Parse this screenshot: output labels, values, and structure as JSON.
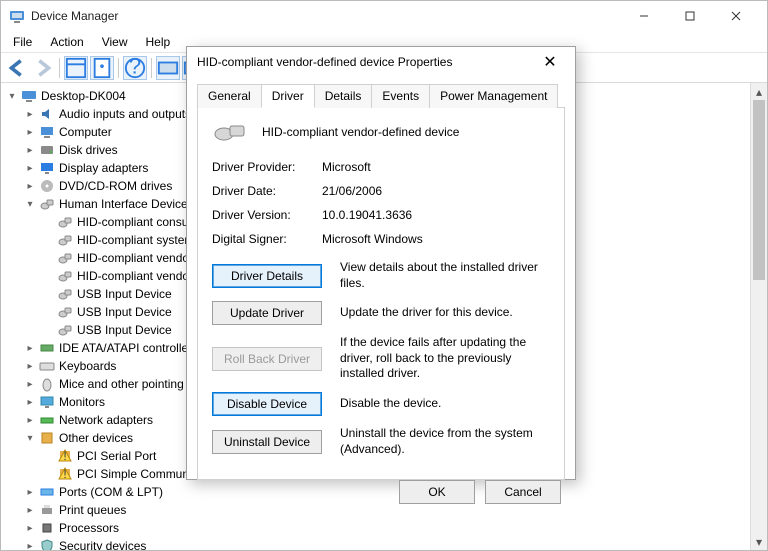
{
  "window": {
    "title": "Device Manager"
  },
  "menubar": [
    "File",
    "Action",
    "View",
    "Help"
  ],
  "tree": {
    "root": "Desktop-DK004",
    "nodes": [
      {
        "label": "Audio inputs and outputs",
        "exp": "collapsed",
        "icon": "audio"
      },
      {
        "label": "Computer",
        "exp": "collapsed",
        "icon": "computer"
      },
      {
        "label": "Disk drives",
        "exp": "collapsed",
        "icon": "disk"
      },
      {
        "label": "Display adapters",
        "exp": "collapsed",
        "icon": "display"
      },
      {
        "label": "DVD/CD-ROM drives",
        "exp": "collapsed",
        "icon": "dvd"
      },
      {
        "label": "Human Interface Devices",
        "exp": "expanded",
        "icon": "hid",
        "children": [
          {
            "label": "HID-compliant consumer control device",
            "icon": "hid"
          },
          {
            "label": "HID-compliant system controller",
            "icon": "hid"
          },
          {
            "label": "HID-compliant vendor-defined device",
            "icon": "hid"
          },
          {
            "label": "HID-compliant vendor-defined device",
            "icon": "hid"
          },
          {
            "label": "USB Input Device",
            "icon": "hid"
          },
          {
            "label": "USB Input Device",
            "icon": "hid"
          },
          {
            "label": "USB Input Device",
            "icon": "hid"
          }
        ]
      },
      {
        "label": "IDE ATA/ATAPI controllers",
        "exp": "collapsed",
        "icon": "ide"
      },
      {
        "label": "Keyboards",
        "exp": "collapsed",
        "icon": "keyboard"
      },
      {
        "label": "Mice and other pointing devices",
        "exp": "collapsed",
        "icon": "mouse"
      },
      {
        "label": "Monitors",
        "exp": "collapsed",
        "icon": "monitor"
      },
      {
        "label": "Network adapters",
        "exp": "collapsed",
        "icon": "network"
      },
      {
        "label": "Other devices",
        "exp": "expanded",
        "icon": "other",
        "children": [
          {
            "label": "PCI Serial Port",
            "icon": "warn"
          },
          {
            "label": "PCI Simple Communications Controller",
            "icon": "warn"
          }
        ]
      },
      {
        "label": "Ports (COM & LPT)",
        "exp": "collapsed",
        "icon": "port"
      },
      {
        "label": "Print queues",
        "exp": "collapsed",
        "icon": "printer"
      },
      {
        "label": "Processors",
        "exp": "collapsed",
        "icon": "cpu"
      },
      {
        "label": "Security devices",
        "exp": "collapsed",
        "icon": "security"
      }
    ]
  },
  "dialog": {
    "title": "HID-compliant vendor-defined device Properties",
    "tabs": [
      "General",
      "Driver",
      "Details",
      "Events",
      "Power Management"
    ],
    "active_tab": "Driver",
    "device_name": "HID-compliant vendor-defined device",
    "info": {
      "provider_label": "Driver Provider:",
      "provider_value": "Microsoft",
      "date_label": "Driver Date:",
      "date_value": "21/06/2006",
      "version_label": "Driver Version:",
      "version_value": "10.0.19041.3636",
      "signer_label": "Digital Signer:",
      "signer_value": "Microsoft Windows"
    },
    "buttons": {
      "details": {
        "label": "Driver Details",
        "desc": "View details about the installed driver files."
      },
      "update": {
        "label": "Update Driver",
        "desc": "Update the driver for this device."
      },
      "rollback": {
        "label": "Roll Back Driver",
        "desc": "If the device fails after updating the driver, roll back to the previously installed driver."
      },
      "disable": {
        "label": "Disable Device",
        "desc": "Disable the device."
      },
      "uninstall": {
        "label": "Uninstall Device",
        "desc": "Uninstall the device from the system (Advanced)."
      }
    },
    "footer": {
      "ok": "OK",
      "cancel": "Cancel"
    }
  }
}
